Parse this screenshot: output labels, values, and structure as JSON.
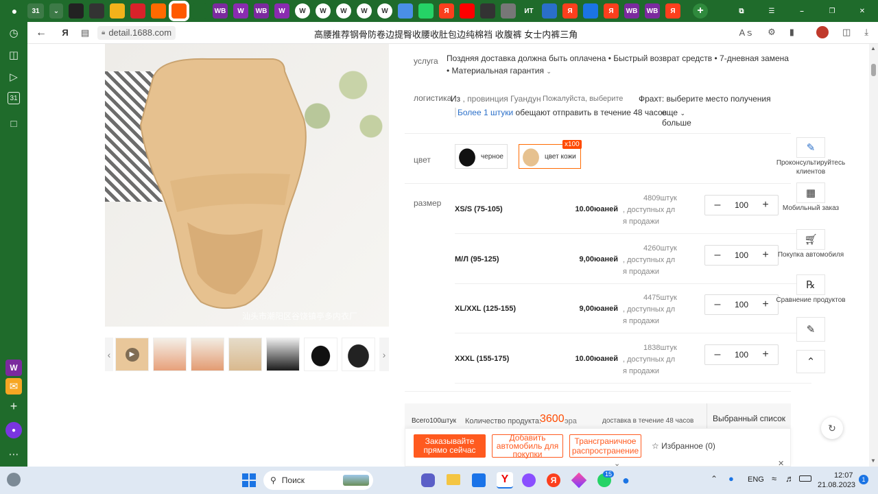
{
  "tab_bar": {
    "counter_badge": "31",
    "tabs": [
      {
        "label": "",
        "icon": "dark-tab-icon"
      },
      {
        "label": "",
        "icon": "infinity-tab-icon"
      },
      {
        "label": "",
        "icon": "mail-tab-icon"
      },
      {
        "label": "",
        "icon": "red-circle-tab-icon"
      },
      {
        "label": "",
        "icon": "orange-tab-icon"
      },
      {
        "label": "",
        "icon": "1688-active-tab-icon"
      },
      {
        "label": "",
        "icon": "red-star-tab-icon"
      },
      {
        "label": "WB",
        "icon": "wb-tab-icon"
      },
      {
        "label": "W",
        "icon": "w-tab-icon"
      },
      {
        "label": "WB",
        "icon": "wb-tab-icon"
      },
      {
        "label": "W",
        "icon": "w-tab-icon"
      },
      {
        "label": "W",
        "icon": "w-circle-tab-icon"
      },
      {
        "label": "W",
        "icon": "w-circle-tab-icon"
      },
      {
        "label": "W",
        "icon": "w-circle-tab-icon"
      },
      {
        "label": "W",
        "icon": "w-circle-tab-icon"
      },
      {
        "label": "W",
        "icon": "w-circle-tab-icon"
      },
      {
        "label": "",
        "icon": "chrome-tab-icon"
      },
      {
        "label": "",
        "icon": "whatsapp-tab-icon"
      },
      {
        "label": "Я",
        "icon": "yandex-tab-icon"
      },
      {
        "label": "",
        "icon": "youtube-tab-icon"
      },
      {
        "label": "",
        "icon": "owl-tab-icon"
      },
      {
        "label": "",
        "icon": "image-tab-icon"
      },
      {
        "label": "ИТ",
        "icon": "it-tab-icon"
      },
      {
        "label": "",
        "icon": "photo-tab-icon"
      },
      {
        "label": "Я",
        "icon": "yandex-tab-icon"
      },
      {
        "label": "",
        "icon": "play-tab-icon"
      },
      {
        "label": "Я",
        "icon": "yandex-tab-icon"
      },
      {
        "label": "WB",
        "icon": "wb-tab-icon"
      },
      {
        "label": "WB",
        "icon": "wb-tab-icon"
      },
      {
        "label": "Я",
        "icon": "yandex-tab-icon"
      }
    ],
    "new_tab": "+"
  },
  "address_bar": {
    "url": "detail.1688.com",
    "page_title": "高腰推荐钢骨防卷边提臀收腰收肚包边纯棉裆 收腹裤 女士内裤三角"
  },
  "product": {
    "watermark": "汕头市潮阳区谷饶镇亭多内衣厂",
    "service_label": "услуга",
    "service_text": "Поздняя доставка должна быть оплачена • Быстрый возврат средств • 7-дневная замена",
    "service_text2": "• Материальная гарантия",
    "logistics_label": "логистика",
    "logistics_from": "Из",
    "logistics_province": ", провинция Гуандун",
    "logistics_select": "Пожалуйста, выберите",
    "freight": "Фрахт: выберите место получения",
    "more_pieces": "Более 1 штуки",
    "promise": "обещают отправить в течение 48 часов",
    "more": "еще",
    "more2": "больше",
    "color_label": "цвет",
    "colors": [
      {
        "name": "черное"
      },
      {
        "name": "цвет кожи",
        "badge": "x100"
      }
    ],
    "size_label": "размер",
    "sizes": [
      {
        "name": "XS/S (75-105)",
        "price": "10.00юаней",
        "stock": "4809штук",
        "avail": ", доступных дл",
        "avail2": "я продажи",
        "qty": "100"
      },
      {
        "name": "М/Л (95-125)",
        "price": "9,00юаней",
        "stock": "4260штук",
        "avail": ", доступных дл",
        "avail2": "я продажи",
        "qty": "100"
      },
      {
        "name": "XL/XXL (125-155)",
        "price": "9,00юаней",
        "stock": "4475штук",
        "avail": ", доступных дл",
        "avail2": "я продажи",
        "qty": "100"
      },
      {
        "name": "XXXL (155-175)",
        "price": "10.00юаней",
        "stock": "1838штук",
        "avail": ", доступных дл",
        "avail2": "я продажи",
        "qty": "100"
      }
    ]
  },
  "summary": {
    "total": "Всего100штук",
    "qty_label": "Количество продукта:",
    "amount": "3600",
    "currency": "эра",
    "delivery": "доставка в течение 48 часов",
    "selected": "Выбранный список"
  },
  "actions": {
    "order_now": "Заказывайте прямо сейчас",
    "add_car": "Добавить автомобиль для покупки",
    "cross_border": "Трансграничное распространение",
    "favorites": "Избранное (0)"
  },
  "side_tools": [
    {
      "label": "Проконсультируйтесь клиентов",
      "icon": "chat-icon"
    },
    {
      "label": "Мобильный заказ",
      "icon": "qr-code-icon"
    },
    {
      "label": "Покупка автомобиля",
      "icon": "cart-icon"
    },
    {
      "label": "Сравнение продуктов",
      "icon": "compare-icon"
    },
    {
      "label": "",
      "icon": "edit-icon"
    },
    {
      "label": "",
      "icon": "scroll-top-icon"
    }
  ],
  "taskbar": {
    "search_placeholder": "Поиск",
    "lang": "ENG",
    "time": "12:07",
    "date": "21.08.2023",
    "notif": "1",
    "whatsapp_badge": "15"
  }
}
